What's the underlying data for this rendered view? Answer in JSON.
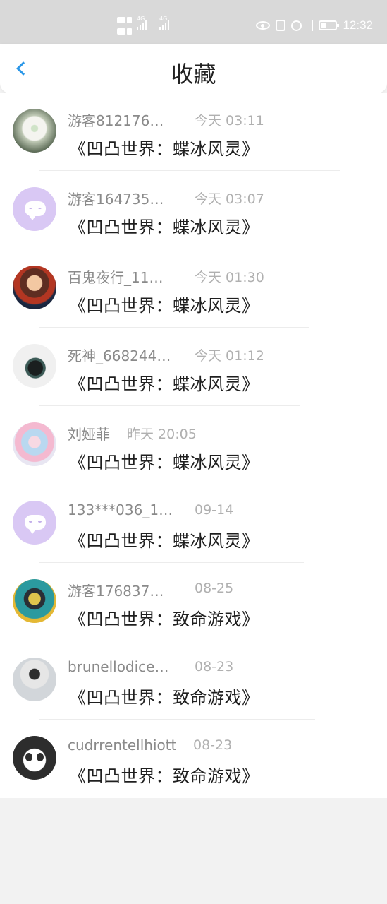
{
  "status_bar": {
    "network_left": "4G",
    "network_right": "4G",
    "time": "12:32",
    "icons": [
      "hd-icon",
      "signal-icon",
      "eye-icon",
      "nfc-icon",
      "alarm-icon",
      "bluetooth-icon",
      "battery-icon"
    ]
  },
  "header": {
    "back_icon": "chevron-left-icon",
    "title": "收藏"
  },
  "colors": {
    "accent": "#2b97e8",
    "status_bar_bg": "#d9d9d9",
    "page_bg": "#f2f2f2"
  },
  "favorites": [
    {
      "user": "游客812176…",
      "time": "今天 03:11",
      "title": "《凹凸世界：蝶冰风灵》",
      "avatar": "flower-avatar"
    },
    {
      "user": "游客164735…",
      "time": "今天 03:07",
      "title": "《凹凸世界：蝶冰风灵》",
      "avatar": "default-chat-avatar"
    },
    {
      "user": "百鬼夜行_11…",
      "time": "今天 01:30",
      "title": "《凹凸世界：蝶冰风灵》",
      "avatar": "anime-avatar"
    },
    {
      "user": "死神_668244…",
      "time": "今天 01:12",
      "title": "《凹凸世界：蝶冰风灵》",
      "avatar": "reaper-avatar"
    },
    {
      "user": "刘娅菲",
      "time": "昨天 20:05",
      "title": "《凹凸世界：蝶冰风灵》",
      "avatar": "anime-girl-avatar"
    },
    {
      "user": "133***036_1…",
      "time": "09-14",
      "title": "《凹凸世界：蝶冰风灵》",
      "avatar": "default-chat-avatar"
    },
    {
      "user": "游客176837…",
      "time": "08-25",
      "title": "《凹凸世界：致命游戏》",
      "avatar": "poster-avatar"
    },
    {
      "user": "brunellodice…",
      "time": "08-23",
      "title": "《凹凸世界：致命游戏》",
      "avatar": "person-avatar"
    },
    {
      "user": "cudrrentellhiott",
      "time": "08-23",
      "title": "《凹凸世界：致命游戏》",
      "avatar": "panda-avatar"
    }
  ]
}
